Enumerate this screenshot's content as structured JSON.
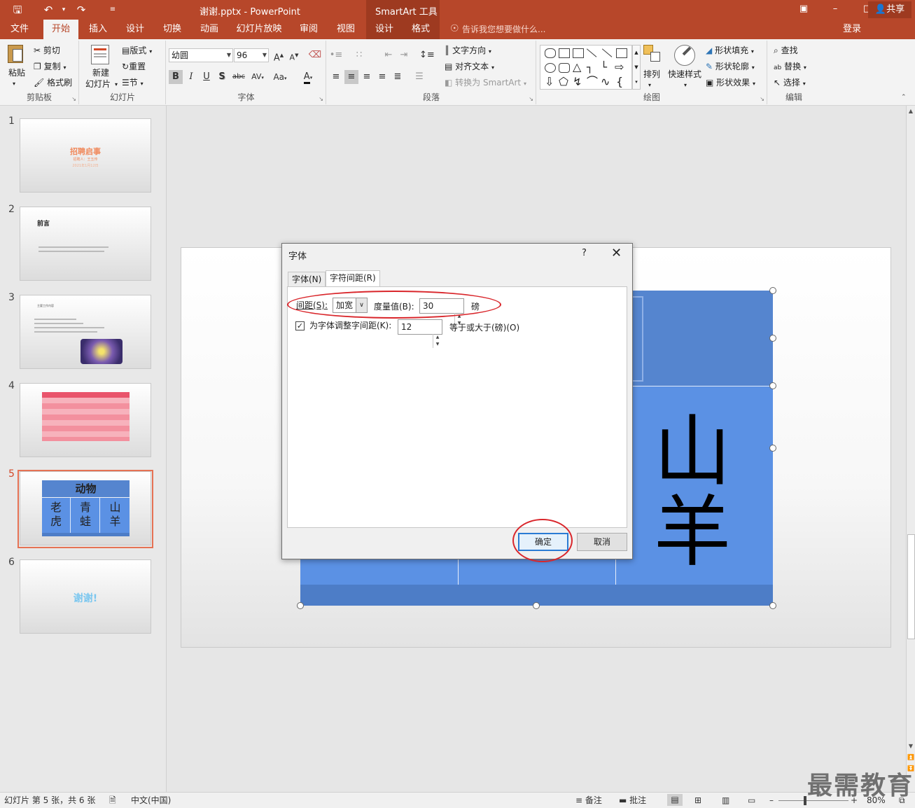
{
  "titlebar": {
    "document_title": "谢谢.pptx - PowerPoint",
    "context_tools": "SmartArt 工具",
    "quick_access": {
      "save_icon": "save-icon",
      "undo_icon": "undo-icon",
      "redo_icon": "redo-icon",
      "customize_icon": "customize-icon"
    },
    "window_buttons": [
      "restore-ribbon-icon",
      "minimize-icon",
      "maximize-icon",
      "close-icon"
    ]
  },
  "ribbon_tabs": {
    "items": [
      "文件",
      "开始",
      "插入",
      "设计",
      "切换",
      "动画",
      "幻灯片放映",
      "审阅",
      "视图",
      "设计",
      "格式"
    ],
    "active": "开始",
    "tell_me": "告诉我您想要做什么...",
    "login": "登录",
    "share": "共享"
  },
  "ribbon": {
    "clipboard": {
      "label": "剪贴板",
      "paste": "粘贴",
      "cut": "剪切",
      "copy": "复制",
      "format_painter": "格式刷"
    },
    "slides": {
      "label": "幻灯片",
      "new_slide_line1": "新建",
      "new_slide_line2": "幻灯片",
      "layout": "版式",
      "reset": "重置",
      "section": "节"
    },
    "font": {
      "label": "字体",
      "font_name": "幼圆",
      "font_size": "96",
      "bold": "B",
      "italic": "I",
      "underline": "U",
      "shadow": "S",
      "strike": "abc",
      "spacing": "AV",
      "case": "Aa",
      "color": "A",
      "grow": "A",
      "shrink": "A"
    },
    "paragraph": {
      "label": "段落",
      "text_direction": "文字方向",
      "align_text": "对齐文本",
      "convert_smartart": "转换为 SmartArt"
    },
    "drawing": {
      "label": "绘图",
      "arrange": "排列",
      "quick_styles": "快速样式",
      "shape_fill": "形状填充",
      "shape_outline": "形状轮廓",
      "shape_effects": "形状效果"
    },
    "editing": {
      "label": "编辑",
      "find": "查找",
      "replace": "替换",
      "select": "选择"
    }
  },
  "slides_pane": {
    "slides": [
      {
        "number": "1",
        "title": "招聘启事",
        "subtitle": "招聘人：王五传",
        "date": "2021年1月12日"
      },
      {
        "number": "2",
        "title": "前言"
      },
      {
        "number": "3",
        "title": "主要工作内容"
      },
      {
        "number": "4",
        "title": ""
      },
      {
        "number": "5",
        "header": "动物",
        "cells": [
          "老虎",
          "青蛙",
          "山羊"
        ]
      },
      {
        "number": "6",
        "title": "谢谢!"
      }
    ],
    "current": "5"
  },
  "slide": {
    "smartart_chars": [
      "山",
      "羊"
    ],
    "colors": {
      "top": "#5585cf",
      "mid": "#5b91e4",
      "bottom": "#4d7dc7"
    }
  },
  "dialog": {
    "title": "字体",
    "help": "?",
    "close": "✕",
    "tabs": [
      "字体(N)",
      "字符间距(R)"
    ],
    "active_tab": "字符间距(R)",
    "spacing_label": "间距(S):",
    "spacing_value": "加宽",
    "by_label": "度量值(B):",
    "by_value": "30",
    "by_unit": "磅",
    "kerning_checked": true,
    "kerning_label": "为字体调整字间距(K):",
    "kerning_value": "12",
    "kerning_suffix": "等于或大于(磅)(O)",
    "ok": "确定",
    "cancel": "取消"
  },
  "status": {
    "slide_info": "幻灯片 第 5 张，共 6 张",
    "language": "中文(中国)",
    "notes": "备注",
    "comments": "批注",
    "zoom": "80%"
  },
  "watermark": "最需教育"
}
